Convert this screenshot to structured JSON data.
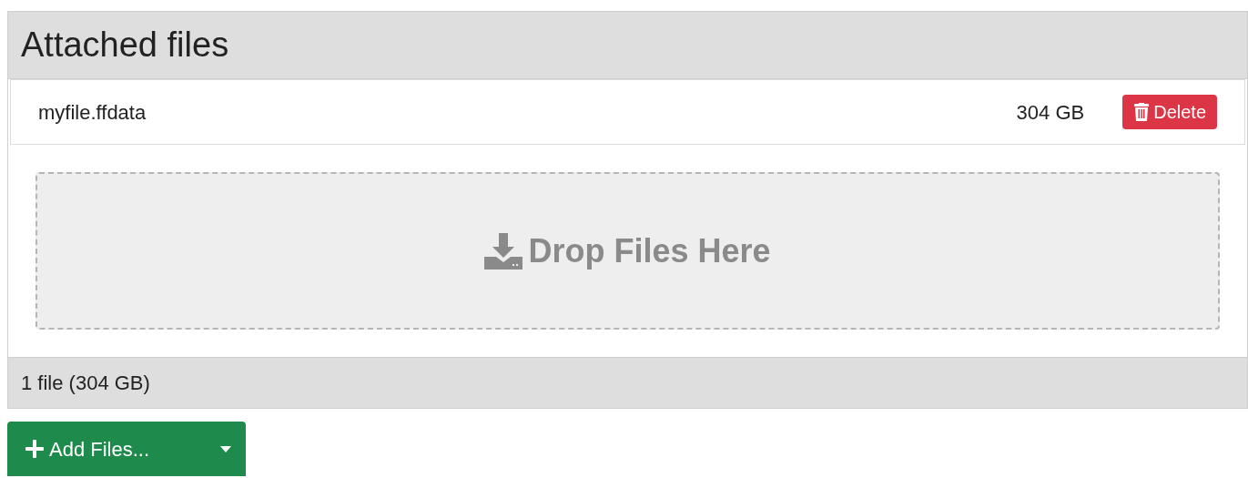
{
  "panel": {
    "title": "Attached files"
  },
  "files": [
    {
      "name": "myfile.ffdata",
      "size": "304 GB",
      "delete_label": "Delete"
    }
  ],
  "drop_zone": {
    "label": "Drop Files Here"
  },
  "footer": "1 file (304 GB)",
  "add_button": {
    "label": "Add Files..."
  }
}
